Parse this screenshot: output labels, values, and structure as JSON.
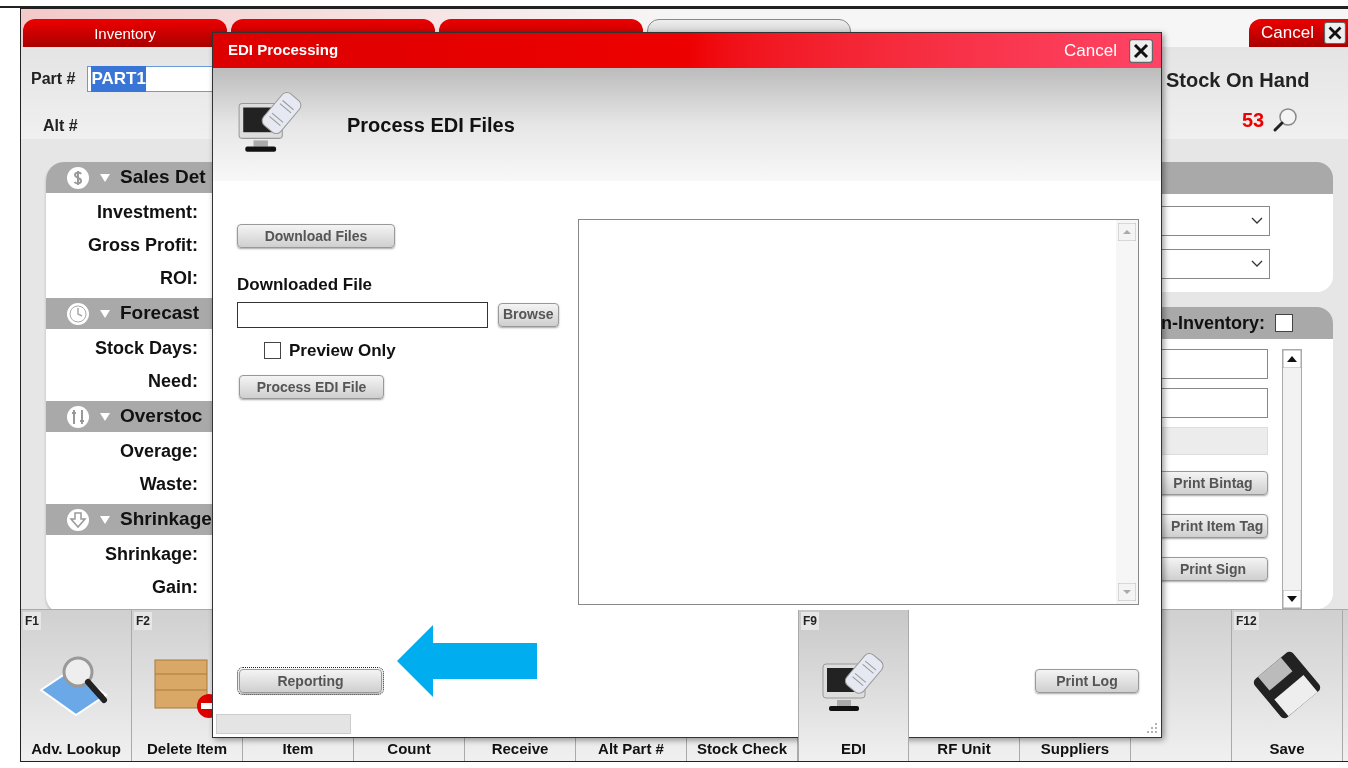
{
  "tabs": [
    {
      "label": "Inventory",
      "selected": false
    },
    {
      "selected": false
    },
    {
      "selected": false
    },
    {
      "selected": true
    }
  ],
  "cancel_button": "Cancel",
  "part": {
    "label": "Part #",
    "value": "PART1",
    "highlighted": true
  },
  "alt": {
    "label": "Alt #"
  },
  "stock_on_hand": {
    "label": "Stock On Hand",
    "value": "53"
  },
  "left_panel": {
    "sections": [
      {
        "kind": "dollar",
        "title": "Sales Det",
        "rows": [
          "Investment:",
          "Gross Profit:",
          "ROI:"
        ]
      },
      {
        "kind": "clock",
        "title": "Forecast",
        "rows": [
          "Stock Days:",
          "Need:"
        ]
      },
      {
        "kind": "tools",
        "title": "Overstoc",
        "rows": [
          "Overage:",
          "Waste:"
        ]
      },
      {
        "kind": "down",
        "title": "Shrinkage",
        "rows": [
          "Shrinkage:",
          "Gain:"
        ]
      }
    ]
  },
  "right_panel": {
    "in_inventory": {
      "label": "n-Inventory:",
      "checked": false
    },
    "buttons": [
      "Print Bintag",
      "Print Item Tag",
      "Print Sign"
    ]
  },
  "toolbar": [
    {
      "key": "F1",
      "label": "Adv. Lookup",
      "kind": "lookup"
    },
    {
      "key": "F2",
      "label": "Delete Item",
      "kind": "delete"
    },
    {
      "label": "Item",
      "kind": "hidden"
    },
    {
      "label": "Count",
      "kind": "hidden"
    },
    {
      "label": "Receive",
      "kind": "hidden"
    },
    {
      "label": "Alt Part #",
      "kind": "hidden"
    },
    {
      "label": "Stock Check",
      "kind": "hidden"
    },
    {
      "key": "F9",
      "label": "EDI",
      "kind": "edi"
    },
    {
      "label": "RF Unit",
      "kind": "hidden"
    },
    {
      "label": "Suppliers",
      "kind": "hidden"
    },
    {
      "kind": "empty"
    },
    {
      "key": "F12",
      "label": "Save",
      "kind": "save"
    }
  ],
  "dialog": {
    "title": "EDI Processing",
    "cancel": "Cancel",
    "heading": "Process EDI Files",
    "download_button": "Download Files",
    "file_label": "Downloaded File",
    "browse_button": "Browse",
    "preview_only": {
      "label": "Preview Only",
      "checked": false
    },
    "process_button": "Process EDI File",
    "reporting_button": "Reporting",
    "print_log_button": "Print Log"
  }
}
